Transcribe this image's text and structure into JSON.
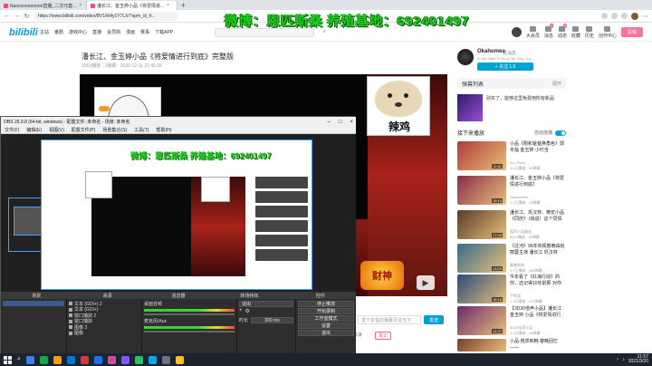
{
  "browser": {
    "tabs": [
      {
        "label": "Nascooooooooo直播_二次元套..."
      },
      {
        "label": "潘长江、金玉婷小品《将爱情进..."
      }
    ],
    "new_tab": "+",
    "url": "https://www.bilibili.com/video/BV1Rt4y1Y7LX/?spm_id_fr..."
  },
  "watermark": "微博：恩匹斯桑 养殖基地：692401497",
  "bili": {
    "logo": "bilibili",
    "nav": [
      "主站",
      "番剧",
      "游戏中心",
      "直播",
      "会员购",
      "漫画",
      "赛事",
      "下载APP"
    ],
    "search_placeholder": "",
    "right_nav": [
      {
        "label": "大会员"
      },
      {
        "label": "消息",
        "badge": "2"
      },
      {
        "label": "动态",
        "badge": "3"
      },
      {
        "label": "收藏"
      },
      {
        "label": "历史"
      },
      {
        "label": "创作中心"
      }
    ],
    "upload_label": "投稿"
  },
  "video": {
    "title": "潘长江、金玉婷小品《将爱情进行到底》完整版",
    "meta": "1553播放 · 2弹幕 · 2020-12-11 21:42:26",
    "stickers": {
      "dog_caption": "辣鸡",
      "stage_logo": "财神",
      "corner_label": "每天"
    },
    "danmaku_placeholder": "发个友善的弹幕见证当下",
    "danmaku_send": "发送",
    "actions": [
      "稿件投诉",
      "笔记"
    ]
  },
  "uploader": {
    "name": "Okahomea",
    "msg": "发消息",
    "desc": "A Yes Want To Sing Out Sing Out",
    "follow": "+ 关注 1.5"
  },
  "sidebar": {
    "danmaku_list": "弹幕列表",
    "danmaku_more": "展开",
    "ad_text": "别买了，能够这里免费用所有新品",
    "next_label": "接下来播放",
    "autoplay_label": "自动连播",
    "recs": [
      {
        "title": "小品《刚和爸爸换角色》郭冬临 金玉婷 小叮当",
        "author": "Ao_Rover",
        "stats": "4.6万播放 · 86弹幕",
        "duration": "12:41",
        "color": "#b03a3a"
      },
      {
        "title": "潘长江、金玉婷小品《将爱情进行到底》",
        "author": "Okahomea",
        "stats": "1.2万播放 · 33弹幕",
        "duration": "15:10",
        "color": "#8a2a4a"
      },
      {
        "title": "潘长江、巩汉林、黄宏小品《同庆》（戏说）这个同情",
        "author": "相声小品精选",
        "stats": "6541播放 · 20弹幕",
        "duration": "17:03",
        "color": "#5a3a2a"
      },
      {
        "title": "《过河》96年央视春晚由赵丽蓉主演 潘长江 巩汉林",
        "author": "春晚经典",
        "stats": "9.7万播放 · 468弹幕",
        "duration": "13:22",
        "color": "#3a6a8a"
      },
      {
        "title": "今年看了《红海行动》的你，还记得10年前那 对你",
        "author": "子荷双",
        "stats": "1.3万播放 · 137弹幕",
        "duration": "15:16",
        "color": "#2a4a7a"
      },
      {
        "title": "【3D30倍声小品】潘长江 金玉婷 小品《将爱情进行",
        "author": "3D30倍声小品",
        "stats": "1.1万播放 · 45弹幕",
        "duration": "14:37",
        "color": "#6a2a6a"
      },
      {
        "title": "小品-荒郊到韩 春晚回忆 ——",
        "author": "",
        "stats": "",
        "duration": "",
        "color": "#7a3a2a"
      }
    ]
  },
  "obs": {
    "title": "OBS 25.0.8 (64-bit, windows) - 配置文件: 未命名 - 场景: 未命名",
    "menu": [
      "文件(F)",
      "编辑(E)",
      "视图(V)",
      "配置文件(P)",
      "场景集合(S)",
      "工具(T)",
      "帮助(H)"
    ],
    "docks": [
      "场景",
      "来源",
      "混音器",
      "转场特效",
      "控件"
    ],
    "sources": [
      "文本 (GDI+) 2",
      "文本 (GDI+)",
      "窗口捕获 2",
      "窗口捕获",
      "图像 3",
      "图像"
    ],
    "mixer": [
      "桌面音频",
      "麦克风/Aux"
    ],
    "transition": {
      "type": "淡出",
      "duration_label": "时长",
      "duration": "300 ms"
    },
    "controls": [
      "停止推流",
      "开始录制",
      "工作室模式",
      "设置",
      "退出"
    ]
  },
  "taskbar": {
    "time": "21:57",
    "date": "2021/3/20",
    "apps": [
      "#3b82f6",
      "#19a74a",
      "#f59e0b",
      "#0078d4",
      "#d9363e",
      "#1a73e8",
      "#d64a9c",
      "#7a5af8",
      "#22c55e",
      "#0ea5e9",
      "#6b7280",
      "#fbbf24"
    ]
  }
}
